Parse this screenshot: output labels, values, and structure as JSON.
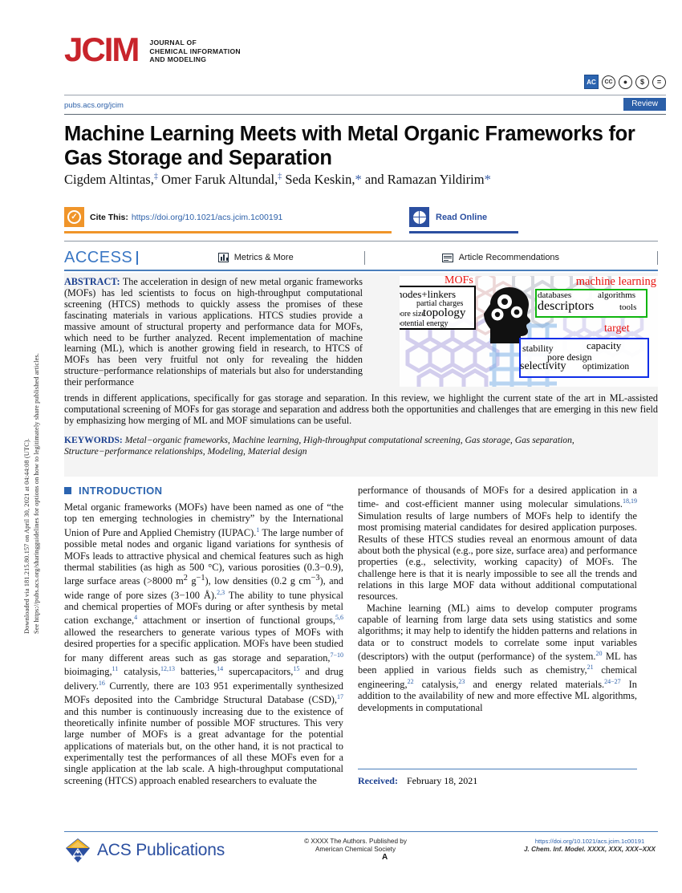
{
  "sidebar": {
    "line1": "Downloaded via 181.215.80.157 on April 30, 2021 at 04:44:08 (UTC).",
    "line2": "See https://pubs.acs.org/sharingguidelines for options on how to legitimately share published articles."
  },
  "header": {
    "logo_text": "JCIM",
    "journal_name": "JOURNAL OF\nCHEMICAL INFORMATION\nAND MODELING",
    "pubs_url": "pubs.acs.org/jcim",
    "article_type": "Review",
    "badge_ac": "AC",
    "badges": [
      "cc",
      "by",
      "nc",
      "nd"
    ]
  },
  "article": {
    "title": "Machine Learning Meets with Metal Organic Frameworks for Gas Storage and Separation",
    "authors_html": "Cigdem Altintas,<sup>‡</sup> Omer Faruk Altundal,<sup>‡</sup> Seda Keskin,<span class=\"star\">*</span> and Ramazan Yildirim<span class=\"star\">*</span>"
  },
  "cite": {
    "label": "Cite This:",
    "doi": "https://doi.org/10.1021/acs.jcim.1c00191",
    "read_online": "Read Online"
  },
  "access_row": {
    "access_label": "ACCESS",
    "metrics": "Metrics & More",
    "recommendations": "Article Recommendations"
  },
  "abstract": {
    "label": "ABSTRACT:",
    "part1": " The acceleration in design of new metal organic frameworks (MOFs) has led scientists to focus on high-throughput computational screening (HTCS) methods to quickly assess the promises of these fascinating materials in various applications. HTCS studies provide a massive amount of structural property and performance data for MOFs, which need to be further analyzed. Recent implementation of machine learning (ML), which is another growing field in research, to HTCS of MOFs has been very fruitful not only for revealing the hidden structure−performance relationships of materials but also for understanding their performance",
    "part2": "trends in different applications, specifically for gas storage and separation. In this review, we highlight the current state of the art in ML-assisted computational screening of MOFs for gas storage and separation and address both the opportunities and challenges that are emerging in this new field by emphasizing how merging of ML and MOF simulations can be useful.",
    "keywords_label": "KEYWORDS:",
    "keywords": " Metal−organic frameworks, Machine learning, High-throughput computational screening, Gas storage, Gas separation, Structure−performance relationships, Modeling, Material design"
  },
  "graphic": {
    "mofs_title": "MOFs",
    "ml_title": "machine learning",
    "target_title": "target",
    "mof_terms": [
      "nodes+linkers",
      "partial charges",
      "pore size",
      "topology",
      "potential energy"
    ],
    "ml_terms": [
      "databases",
      "algorithms",
      "descriptors",
      "tools"
    ],
    "target_terms": [
      "stability",
      "capacity",
      "pore design",
      "selectivity",
      "optimization"
    ],
    "colors": {
      "red": "#e8130f",
      "green_box": "#0fb50f",
      "blue_box": "#0f2ee8",
      "black_box": "#000000"
    }
  },
  "sections": {
    "introduction_heading": "INTRODUCTION"
  },
  "column_left": {
    "p1": "Metal organic frameworks (MOFs) have been named as one of “the top ten emerging technologies in chemistry” by the International Union of Pure and Applied Chemistry (IUPAC).<sup class=\"ref\">1</sup> The large number of possible metal nodes and organic ligand variations for synthesis of MOFs leads to attractive physical and chemical features such as high thermal stabilities (as high as 500 °C), various porosities (0.3−0.9), large surface areas (&gt;8000 m<sup>2</sup> g<sup>−1</sup>), low densities (0.2 g cm<sup>−3</sup>), and wide range of pore sizes (3−100 Å).<sup class=\"ref\">2,3</sup> The ability to tune physical and chemical properties of MOFs during or after synthesis by metal cation exchange,<sup class=\"ref\">4</sup> attachment or insertion of functional groups,<sup class=\"ref\">5,6</sup> allowed the researchers to generate various types of MOFs with desired properties for a specific application. MOFs have been studied for many different areas such as gas storage and separation,<sup class=\"ref\">7−10</sup> bioimaging,<sup class=\"ref\">11</sup> catalysis,<sup class=\"ref\">12,13</sup> batteries,<sup class=\"ref\">14</sup> supercapacitors,<sup class=\"ref\">15</sup> and drug delivery.<sup class=\"ref\">16</sup> Currently, there are 103 951 experimentally synthesized MOFs deposited into the Cambridge Structural Database (CSD),<sup class=\"ref\">17</sup> and this number is continuously increasing due to the existence of theoretically infinite number of possible MOF structures. This very large number of MOFs is a great advantage for the potential applications of materials but, on the other hand, it is not practical to experimentally test the performances of all these MOFs even for a single application at the lab scale. A high-throughput computational screening (HTCS) approach enabled researchers to evaluate the"
  },
  "column_right": {
    "p1": "performance of thousands of MOFs for a desired application in a time- and cost-efficient manner using molecular simulations.<sup class=\"ref\">18,19</sup> Simulation results of large numbers of MOFs help to identify the most promising material candidates for desired application purposes. Results of these HTCS studies reveal an enormous amount of data about both the physical (e.g., pore size, surface area) and performance properties (e.g., selectivity, working capacity) of MOFs. The challenge here is that it is nearly impossible to see all the trends and relations in this large MOF data without additional computational resources.",
    "p2": "Machine learning (ML) aims to develop computer programs capable of learning from large data sets using statistics and some algorithms; it may help to identify the hidden patterns and relations in data or to construct models to correlate some input variables (descriptors) with the output (performance) of the system.<sup class=\"ref\">20</sup> ML has been applied in various fields such as chemistry,<sup class=\"ref\">21</sup> chemical engineering,<sup class=\"ref\">22</sup> catalysis,<sup class=\"ref\">23</sup> and energy related materials.<sup class=\"ref\">24−27</sup> In addition to the availability of new and more effective ML algorithms, developments in computational",
    "received_label": "Received:",
    "received_date": "February 18, 2021"
  },
  "footer": {
    "publisher": "ACS Publications",
    "copyright_line1": "© XXXX The Authors. Published by",
    "copyright_line2": "American Chemical Society",
    "page_mark": "A",
    "doi": "https://doi.org/10.1021/acs.jcim.1c00191",
    "journal_ref": "J. Chem. Inf. Model. XXXX, XXX, XXX−XXX"
  }
}
